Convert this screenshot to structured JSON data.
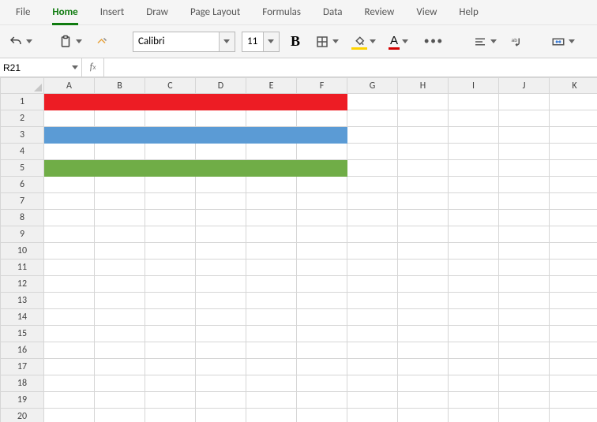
{
  "tabs": [
    "File",
    "Home",
    "Insert",
    "Draw",
    "Page Layout",
    "Formulas",
    "Data",
    "Review",
    "View",
    "Help"
  ],
  "active_tab": "Home",
  "font": {
    "name": "Calibri",
    "size": "11"
  },
  "namebox": "R21",
  "formula": "",
  "columns": [
    "A",
    "B",
    "C",
    "D",
    "E",
    "F",
    "G",
    "H",
    "I",
    "J",
    "K"
  ],
  "rows": 20,
  "painted_rows": {
    "1": "#ed1c24",
    "3": "#5b9bd5",
    "5": "#70ad47"
  },
  "painted_cols": [
    "A",
    "B",
    "C",
    "D",
    "E",
    "F"
  ],
  "icons": {
    "undo": "undo-icon",
    "paste": "paste-icon",
    "brush": "format-painter-icon",
    "bold": "bold-icon",
    "borders": "borders-icon",
    "fill": "fill-color-icon",
    "font_color": "font-color-icon",
    "more": "more-icon",
    "align": "align-icon",
    "wrap": "wrap-text-icon",
    "merge": "merge-icon"
  }
}
